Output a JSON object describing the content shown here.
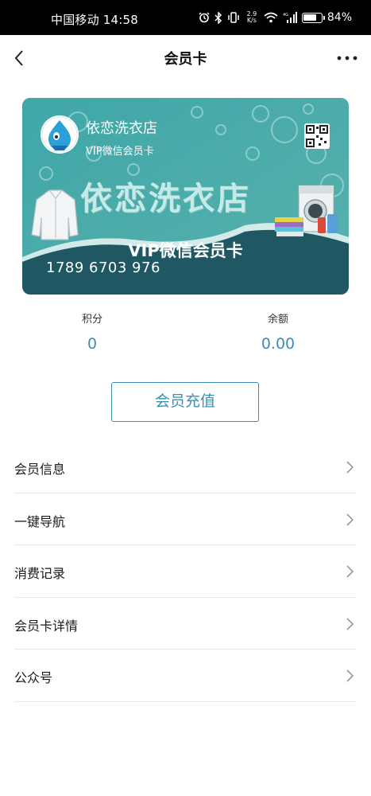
{
  "status_bar": {
    "carrier_time": "中国移动 14:58",
    "net_speed": "2.9\nK/s",
    "battery_percent": "84%",
    "battery_level": 0.84,
    "icons": [
      "alarm-icon",
      "bluetooth-icon",
      "vibrate-icon",
      "wifi-icon",
      "signal-icon",
      "battery-icon"
    ]
  },
  "nav": {
    "title": "会员卡",
    "back_icon": "chevron-left-icon",
    "more_icon": "more-dots-icon"
  },
  "card": {
    "store_name": "依恋洗衣店",
    "subtitle": "VIP微信会员卡",
    "big_title": "依恋洗衣店",
    "vip_label": "VIP微信会员卡",
    "card_number": "1789 6703 976",
    "colors": {
      "teal": "#48a8a6",
      "dark": "#1f5763",
      "wave": "#2f7f85"
    }
  },
  "stats": {
    "points_label": "积分",
    "points_value": "0",
    "balance_label": "余额",
    "balance_value": "0.00"
  },
  "recharge_button": "会员充值",
  "menu": [
    {
      "label": "会员信息"
    },
    {
      "label": "一键导航"
    },
    {
      "label": "消费记录"
    },
    {
      "label": "会员卡详情"
    },
    {
      "label": "公众号"
    }
  ],
  "accent_color": "#3a8fb0"
}
